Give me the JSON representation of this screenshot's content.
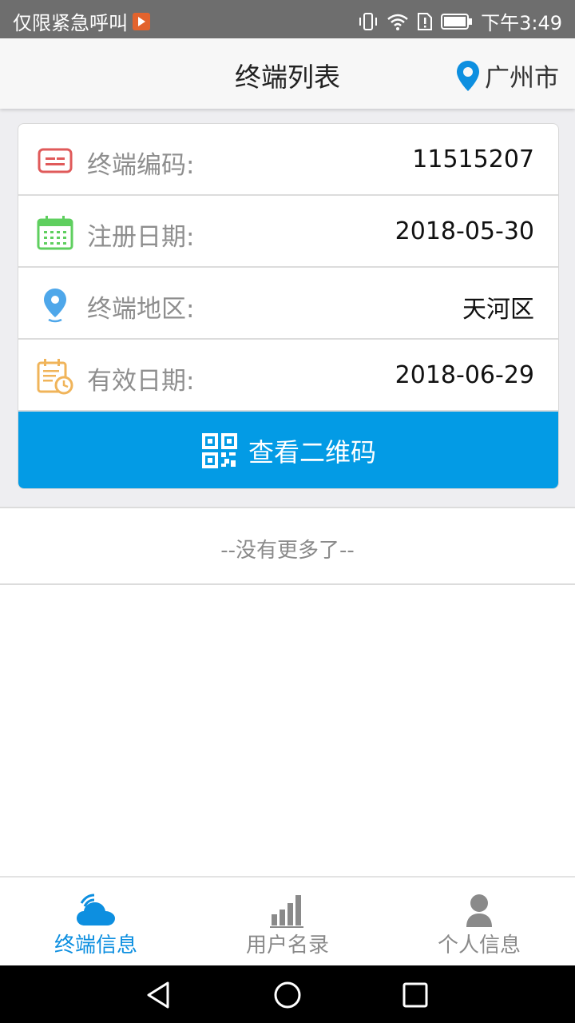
{
  "status_bar": {
    "carrier_text": "仅限紧急呼叫",
    "time": "下午3:49"
  },
  "header": {
    "title": "终端列表",
    "city": "广州市"
  },
  "terminal": {
    "rows": [
      {
        "label": "终端编码:",
        "value": "11515207",
        "icon": "id-card-icon",
        "color": "#e05a5a"
      },
      {
        "label": "注册日期:",
        "value": "2018-05-30",
        "icon": "calendar-icon",
        "color": "#5fcf5f"
      },
      {
        "label": "终端地区:",
        "value": "天河区",
        "icon": "location-pin-icon",
        "color": "#4ea7ea"
      },
      {
        "label": "有效日期:",
        "value": "2018-06-29",
        "icon": "calendar-clock-icon",
        "color": "#f0b45a"
      }
    ],
    "qr_button_label": "查看二维码"
  },
  "list_footer": "--没有更多了--",
  "tabs": [
    {
      "label": "终端信息",
      "icon": "cloud-signal-icon",
      "active": true
    },
    {
      "label": "用户名录",
      "icon": "bar-chart-icon",
      "active": false
    },
    {
      "label": "个人信息",
      "icon": "person-icon",
      "active": false
    }
  ],
  "colors": {
    "accent": "#039be5",
    "active_tab": "#0d8fe0"
  }
}
